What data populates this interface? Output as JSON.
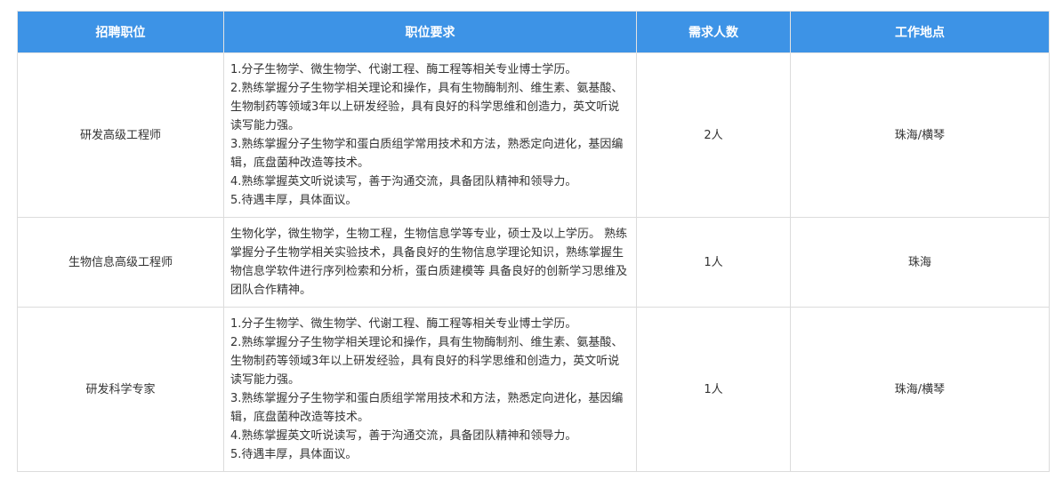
{
  "table": {
    "headers": [
      "招聘职位",
      "职位要求",
      "需求人数",
      "工作地点"
    ],
    "rows": [
      {
        "position": "研发高级工程师",
        "requirements": [
          "1.分子生物学、微生物学、代谢工程、酶工程等相关专业博士学历。",
          "2.熟练掌握分子生物学相关理论和操作，具有生物酶制剂、维生素、氨基酸、生物制药等领域3年以上研发经验，具有良好的科学思维和创造力，英文听说读写能力强。",
          "3.熟练掌握分子生物学和蛋白质组学常用技术和方法，熟悉定向进化，基因编辑，底盘菌种改造等技术。",
          "4.熟练掌握英文听说读写，善于沟通交流，具备团队精神和领导力。",
          "5.待遇丰厚，具体面议。"
        ],
        "count": "2人",
        "location": "珠海/横琴"
      },
      {
        "position": "生物信息高级工程师",
        "requirements": [
          "生物化学，微生物学，生物工程，生物信息学等专业，硕士及以上学历。 熟练掌握分子生物学相关实验技术，具备良好的生物信息学理论知识，熟练掌握生物信息学软件进行序列检索和分析，蛋白质建模等 具备良好的创新学习思维及团队合作精神。"
        ],
        "count": "1人",
        "location": "珠海"
      },
      {
        "position": "研发科学专家",
        "requirements": [
          "1.分子生物学、微生物学、代谢工程、酶工程等相关专业博士学历。",
          "2.熟练掌握分子生物学相关理论和操作，具有生物酶制剂、维生素、氨基酸、生物制药等领域3年以上研发经验，具有良好的科学思维和创造力，英文听说读写能力强。",
          "3.熟练掌握分子生物学和蛋白质组学常用技术和方法，熟悉定向进化，基因编辑，底盘菌种改造等技术。",
          "4.熟练掌握英文听说读写，善于沟通交流，具备团队精神和领导力。",
          "5.待遇丰厚，具体面议。"
        ],
        "count": "1人",
        "location": "珠海/横琴"
      }
    ]
  },
  "colors": {
    "header_bg": "#3d93e6",
    "header_text": "#ffffff",
    "border": "#dcdcdc",
    "body_text": "#333333"
  }
}
